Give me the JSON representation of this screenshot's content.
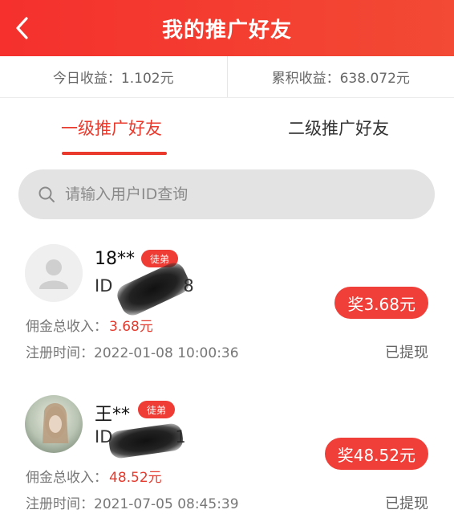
{
  "header": {
    "title": "我的推广好友",
    "back_icon": "chevron-left-icon"
  },
  "earnings": {
    "today_label": "今日收益：",
    "today_value": "1.102元",
    "total_label": "累积收益：",
    "total_value": "638.072元"
  },
  "tabs": [
    {
      "label": "一级推广好友",
      "active": true
    },
    {
      "label": "二级推广好友",
      "active": false
    }
  ],
  "search": {
    "placeholder": "请输入用户ID查询",
    "icon": "search-icon"
  },
  "friends": [
    {
      "name": "18**",
      "badge": "徒弟",
      "id_prefix": "ID",
      "id_suffix": "8",
      "commission_label": "佣金总收入：",
      "commission_value": "3.68元",
      "reward": "奖3.68元",
      "register_label": "注册时间：",
      "register_time": "2022-01-08 10:00:36",
      "status": "已提现"
    },
    {
      "name": "王**",
      "badge": "徒弟",
      "id_prefix": "ID",
      "id_suffix": "1",
      "commission_label": "佣金总收入：",
      "commission_value": "48.52元",
      "reward": "奖48.52元",
      "register_label": "注册时间：",
      "register_time": "2021-07-05 08:45:39",
      "status": "已提现"
    }
  ],
  "colors": {
    "brand": "#f5302d",
    "accent": "#ea3a2d",
    "badge": "#ef3c35"
  }
}
